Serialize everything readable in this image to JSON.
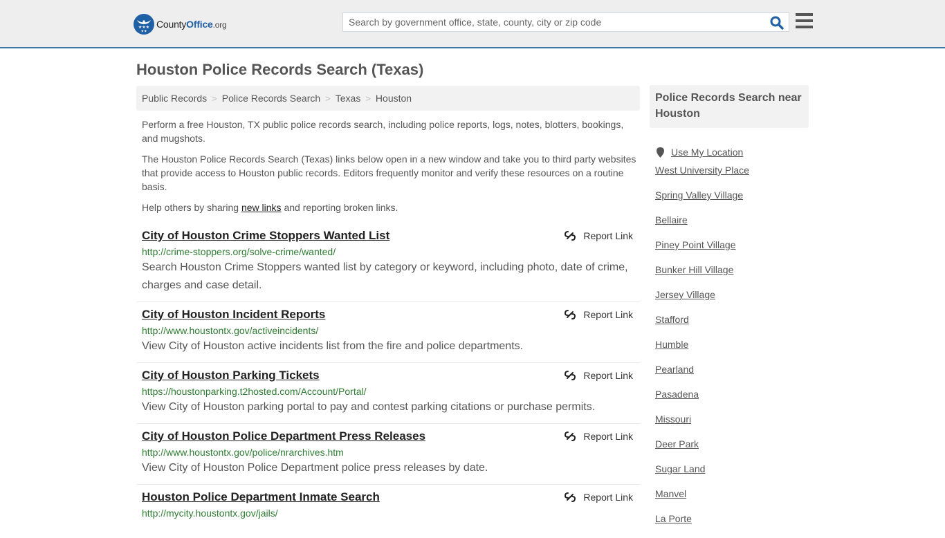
{
  "header": {
    "logo": {
      "name": "County",
      "office": "Office",
      "tld": ".org"
    },
    "search": {
      "placeholder": "Search by government office, state, county, city or zip code",
      "value": ""
    },
    "icons": {
      "search": "search-icon",
      "menu": "hamburger-menu-icon"
    }
  },
  "page": {
    "title": "Houston Police Records Search (Texas)",
    "breadcrumb": [
      "Public Records",
      "Police Records Search",
      "Texas",
      "Houston"
    ],
    "breadcrumb_separator": ">",
    "intro": {
      "p1": "Perform a free Houston, TX public police records search, including police reports, logs, notes, blotters, bookings, and mugshots.",
      "p2": "The Houston Police Records Search (Texas) links below open in a new window and take you to third party websites that provide access to Houston public records. Editors frequently monitor and verify these resources on a routine basis.",
      "p3_before": "Help others by sharing ",
      "p3_link": "new links",
      "p3_after": " and reporting broken links."
    }
  },
  "results": [
    {
      "title": "City of Houston Crime Stoppers Wanted List",
      "url": "http://crime-stoppers.org/solve-crime/wanted/",
      "description": "Search Houston Crime Stoppers wanted list by category or keyword, including photo, date of crime, charges and case detail.",
      "report_label": "Report Link"
    },
    {
      "title": "City of Houston Incident Reports",
      "url": "http://www.houstontx.gov/activeincidents/",
      "description": "View City of Houston active incidents list from the fire and police departments.",
      "report_label": "Report Link"
    },
    {
      "title": "City of Houston Parking Tickets",
      "url": "https://houstonparking.t2hosted.com/Account/Portal/",
      "description": "View City of Houston parking portal to pay and contest parking citations or purchase permits.",
      "report_label": "Report Link"
    },
    {
      "title": "City of Houston Police Department Press Releases",
      "url": "http://www.houstontx.gov/police/nrarchives.htm",
      "description": "View City of Houston Police Department police press releases by date.",
      "report_label": "Report Link"
    },
    {
      "title": "Houston Police Department Inmate Search",
      "url": "http://mycity.houstontx.gov/jails/",
      "description": "",
      "report_label": "Report Link"
    }
  ],
  "sidebar": {
    "heading": "Police Records Search near Houston",
    "use_location": "Use My Location",
    "nearby": [
      "West University Place",
      "Spring Valley Village",
      "Bellaire",
      "Piney Point Village",
      "Bunker Hill Village",
      "Jersey Village",
      "Stafford",
      "Humble",
      "Pearland",
      "Pasadena",
      "Missouri",
      "Deer Park",
      "Sugar Land",
      "Manvel",
      "La Porte"
    ]
  },
  "colors": {
    "brand_blue": "#1f5fa6",
    "header_border": "#3b7aab",
    "url_green": "#2e7d32"
  }
}
